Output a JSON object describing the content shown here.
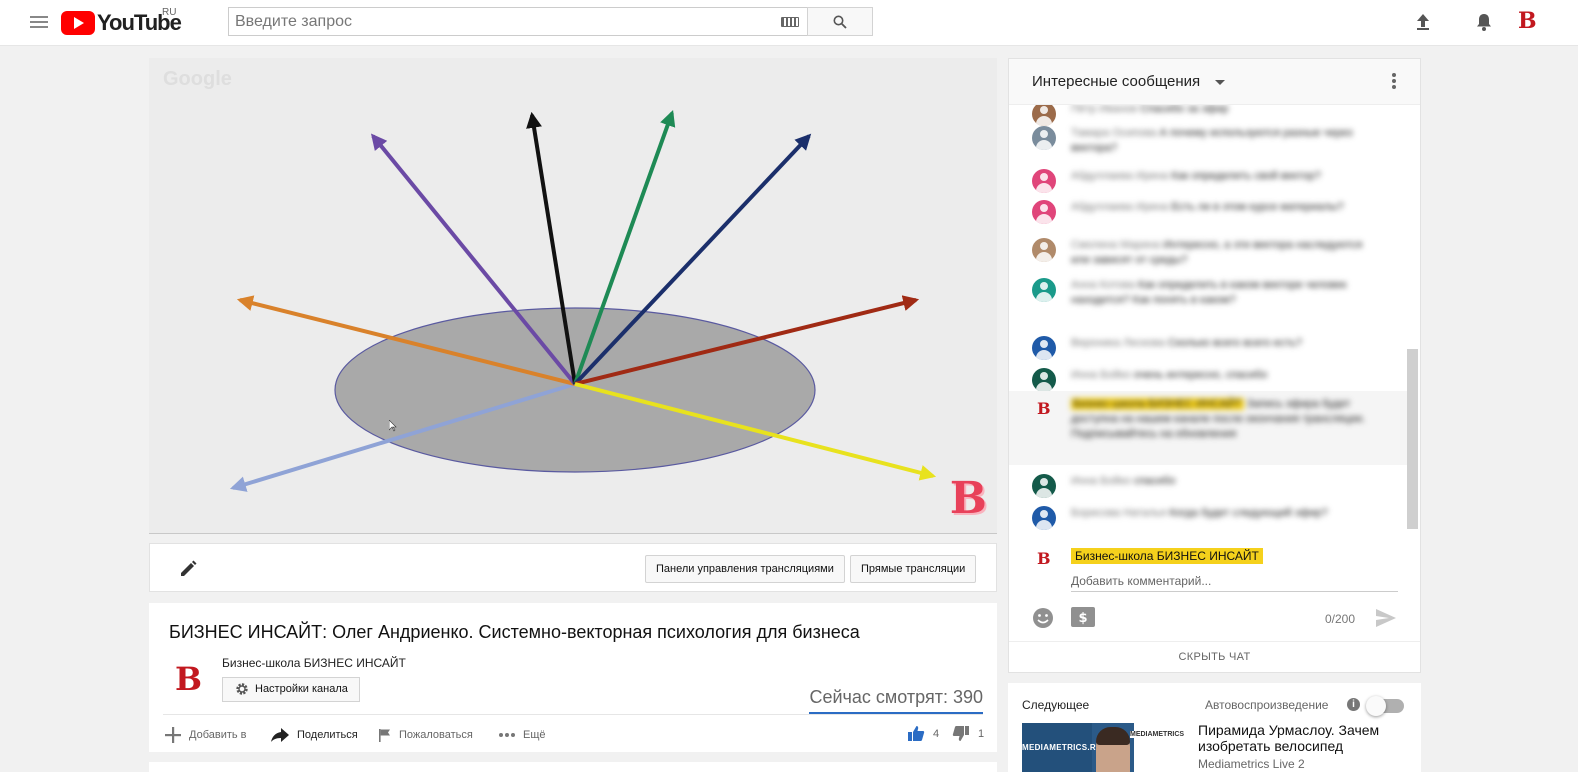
{
  "header": {
    "logo_text": "YouTube",
    "region": "RU",
    "search_placeholder": "Введите запрос",
    "avatar_letter": "B"
  },
  "player": {
    "watermark": "Google",
    "corner_logo": "B",
    "arrow_colors": [
      "#6b4aa5",
      "#111111",
      "#1e8a55",
      "#1b2f6b",
      "#d9822b",
      "#a02a14",
      "#8fa3d6",
      "#e8e21e"
    ],
    "disk_color": "#a9a9a9"
  },
  "strip": {
    "dashboard_button": "Панели управления трансляциями",
    "live_button": "Прямые трансляции"
  },
  "video": {
    "title": "БИЗНЕС ИНСАЙТ: Олег Андриенко. Системно-векторная психология для бизнеса",
    "channel_logo": "B",
    "channel_name": "Бизнес-школа БИЗНЕС ИНСАЙТ",
    "channel_settings": "Настройки канала",
    "viewers": "Сейчас смотрят: 390",
    "actions": {
      "add": "Добавить в",
      "share": "Поделиться",
      "report": "Пожаловаться",
      "more": "Ещё"
    },
    "likes": "4",
    "dislikes": "1"
  },
  "chat": {
    "title": "Интересные сообщения",
    "messages": [
      {
        "author": "Пётр Иванов",
        "text": "Спасибо за эфир",
        "avatar_color": "#9c6b4a"
      },
      {
        "author": "Тамара Осипова",
        "text": "А почему используются разные через вектора?",
        "avatar_color": "#7a8c9c"
      },
      {
        "author": "Абдуллаева Ирина",
        "text": "Как определить свой вектор?",
        "avatar_color": "#e0457a"
      },
      {
        "author": "Абдуллаева Ирина",
        "text": "Есть ли в этом курсе материалы?",
        "avatar_color": "#e0457a"
      },
      {
        "author": "Смолина Марина",
        "text": "Интересно, а эти вектора наследуются или зависят от среды?",
        "avatar_color": "#b08a6a"
      },
      {
        "author": "Анна Котова",
        "text": "Как определить в каком векторе человек находится? Как понять в каком?",
        "avatar_color": "#1a9a8a"
      },
      {
        "author": "Вероника Лескова",
        "text": "Сколько всего всего есть?",
        "avatar_color": "#1f5aa8"
      },
      {
        "author": "Инна Бойко",
        "text": "очень интересно, спасибо",
        "avatar_color": "#145a4a"
      },
      {
        "author": "Бизнес-школа БИЗНЕС ИНСАЙТ",
        "text": "Запись эфира будет доступна на нашем канале после окончания трансляции. Подписывайтесь на обновления",
        "avatar_color": "#ffffff",
        "highlight": true
      },
      {
        "author": "Инна Бойко",
        "text": "спасибо",
        "avatar_color": "#145a4a"
      },
      {
        "author": "Борисова Наталья",
        "text": "Когда будет следующий эфир?",
        "avatar_color": "#1f5aa8"
      }
    ],
    "compose_author": "Бизнес-школа БИЗНЕС ИНСАЙТ",
    "compose_placeholder": "Добавить комментарий...",
    "counter": "0/200",
    "hide_chat": "СКРЫТЬ ЧАТ"
  },
  "upnext": {
    "title": "Следующее",
    "autoplay_label": "Автовоспроизведение",
    "autoplay_on": false,
    "thumb_brand": "MEDIAMETRICS.RU",
    "thumb_brand2": "MEDIAMETRICS",
    "next_title": "Пирамида Урмаслоу. Зачем изобретать велосипед",
    "next_channel": "Mediametrics Live 2"
  }
}
